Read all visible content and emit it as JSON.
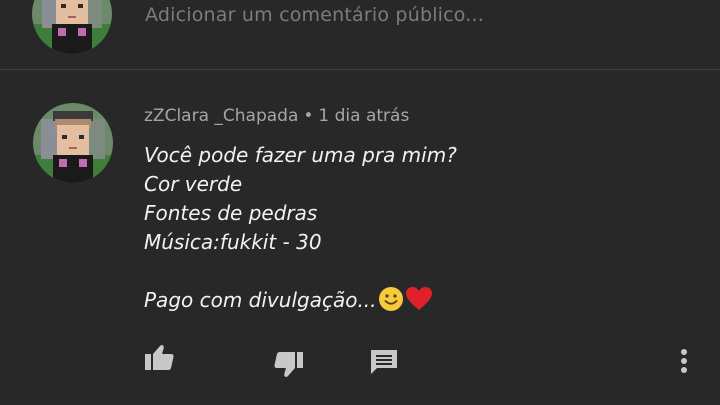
{
  "composer": {
    "placeholder": "Adicionar um comentário público..."
  },
  "comment": {
    "author": "zZClara _Chapada",
    "separator": "•",
    "time": "1 dia atrás",
    "lines": [
      "Você pode fazer uma pra mim?",
      "Cor verde",
      "Fontes de pedras",
      "Música:fukkit - 30"
    ],
    "closing": "Pago com divulgação..."
  },
  "actions": {
    "like_icon": "thumbs-up-icon",
    "dislike_icon": "thumbs-down-icon",
    "reply_icon": "reply-comment-icon",
    "menu_icon": "more-vert-icon"
  },
  "colors": {
    "background": "#282828",
    "text_primary": "#f2f2f2",
    "text_secondary": "#a6a6a6",
    "placeholder": "#7c7c7c",
    "icon": "#c8c8c8",
    "divider": "#3f3f3f"
  }
}
